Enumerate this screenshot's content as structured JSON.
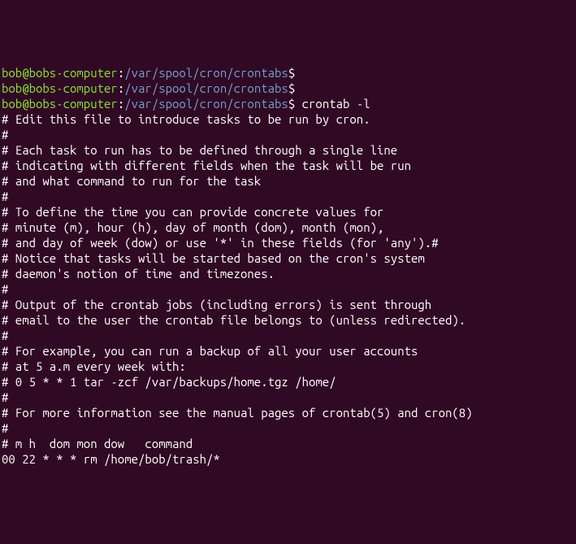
{
  "lines": [
    {
      "type": "prompt",
      "user": "bob@bobs-computer",
      "sep": ":",
      "path": "/var/spool/cron/crontabs",
      "dollar": "$",
      "command": ""
    },
    {
      "type": "prompt",
      "user": "bob@bobs-computer",
      "sep": ":",
      "path": "/var/spool/cron/crontabs",
      "dollar": "$",
      "command": ""
    },
    {
      "type": "prompt",
      "user": "bob@bobs-computer",
      "sep": ":",
      "path": "/var/spool/cron/crontabs",
      "dollar": "$",
      "command": " crontab -l"
    },
    {
      "type": "out",
      "text": "# Edit this file to introduce tasks to be run by cron."
    },
    {
      "type": "out",
      "text": "#"
    },
    {
      "type": "out",
      "text": "# Each task to run has to be defined through a single line"
    },
    {
      "type": "out",
      "text": "# indicating with different fields when the task will be run"
    },
    {
      "type": "out",
      "text": "# and what command to run for the task"
    },
    {
      "type": "out",
      "text": "#"
    },
    {
      "type": "out",
      "text": "# To define the time you can provide concrete values for"
    },
    {
      "type": "out",
      "text": "# minute (m), hour (h), day of month (dom), month (mon),"
    },
    {
      "type": "out",
      "text": "# and day of week (dow) or use '*' in these fields (for 'any').#"
    },
    {
      "type": "out",
      "text": "# Notice that tasks will be started based on the cron's system"
    },
    {
      "type": "out",
      "text": "# daemon's notion of time and timezones."
    },
    {
      "type": "out",
      "text": "#"
    },
    {
      "type": "out",
      "text": "# Output of the crontab jobs (including errors) is sent through"
    },
    {
      "type": "out",
      "text": "# email to the user the crontab file belongs to (unless redirected)."
    },
    {
      "type": "out",
      "text": "#"
    },
    {
      "type": "out",
      "text": "# For example, you can run a backup of all your user accounts"
    },
    {
      "type": "out",
      "text": "# at 5 a.m every week with:"
    },
    {
      "type": "out",
      "text": "# 0 5 * * 1 tar -zcf /var/backups/home.tgz /home/"
    },
    {
      "type": "out",
      "text": "#"
    },
    {
      "type": "out",
      "text": "# For more information see the manual pages of crontab(5) and cron(8)"
    },
    {
      "type": "out",
      "text": "#"
    },
    {
      "type": "out",
      "text": "# m h  dom mon dow   command"
    },
    {
      "type": "out",
      "text": ""
    },
    {
      "type": "out",
      "text": "00 22 * * * rm /home/bob/trash/*"
    }
  ]
}
